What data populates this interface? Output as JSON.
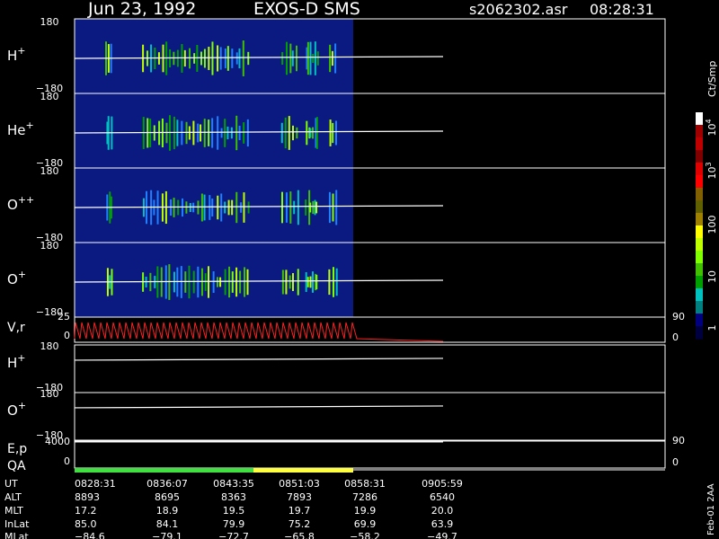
{
  "header": {
    "date": "Jun 23, 1992",
    "instrument": "EXOS-D SMS",
    "file": "s2062302.asr",
    "time": "08:28:31"
  },
  "colorbar": {
    "unit": "Ct/Smp",
    "tick_labels": [
      {
        "base": "10",
        "exp": "4"
      },
      {
        "base": "10",
        "exp": "3"
      },
      {
        "base": "100",
        "exp": ""
      },
      {
        "base": "10",
        "exp": ""
      },
      {
        "base": "1",
        "exp": ""
      }
    ],
    "colors": [
      "#ffffff",
      "#a00000",
      "#c00000",
      "#800000",
      "#e00000",
      "#ff0000",
      "#806000",
      "#606000",
      "#a08000",
      "#ffff00",
      "#c0ff00",
      "#80ff00",
      "#40c000",
      "#00a000",
      "#00c0c0",
      "#008080",
      "#000080",
      "#000040"
    ]
  },
  "footer_note": "Feb-01 2AA",
  "chart_data": {
    "type": "heatmap",
    "spectrogram_panels": [
      {
        "name": "H",
        "sup": "+",
        "ylim": [
          -180,
          180
        ],
        "yticks": [
          "180",
          "−180"
        ]
      },
      {
        "name": "He",
        "sup": "+",
        "ylim": [
          -180,
          180
        ],
        "yticks": [
          "180",
          "−180"
        ]
      },
      {
        "name": "O",
        "sup": "++",
        "ylim": [
          -180,
          180
        ],
        "yticks": [
          "180",
          "−180"
        ]
      },
      {
        "name": "O",
        "sup": "+",
        "ylim": [
          -180,
          180
        ],
        "yticks": [
          "180",
          "−180"
        ]
      }
    ],
    "vr_panel": {
      "label": "V,r",
      "left_ticks": [
        "25",
        "0"
      ],
      "right_ticks": [
        "90",
        "0"
      ],
      "trace_color": "#ff2020"
    },
    "line_panels": [
      {
        "name": "H",
        "sup": "+",
        "yticks": [
          "180",
          "−180"
        ]
      },
      {
        "name": "O",
        "sup": "+",
        "yticks": [
          "180",
          "−180"
        ]
      }
    ],
    "ep_panel": {
      "label": "E,p",
      "left_ticks": [
        "4000",
        "0"
      ],
      "right_ticks": [
        "90",
        "0"
      ]
    },
    "qa": {
      "label": "QA",
      "segments": [
        {
          "from": "0828:31",
          "to": "0843:35",
          "color": "#40e040"
        },
        {
          "from": "0843:35",
          "to": "0858:31",
          "color": "#ffff40"
        }
      ]
    },
    "ephemeris": {
      "row_labels": [
        "UT",
        "ALT",
        "MLT",
        "InLat",
        "MLat"
      ],
      "columns": [
        [
          "0828:31",
          "8893",
          "17.2",
          "85.0",
          "−84.6"
        ],
        [
          "0836:07",
          "8695",
          "18.9",
          "84.1",
          "−79.1"
        ],
        [
          "0843:35",
          "8363",
          "19.5",
          "79.9",
          "−72.7"
        ],
        [
          "0851:03",
          "7893",
          "19.7",
          "75.2",
          "−65.8"
        ],
        [
          "0858:31",
          "7286",
          "19.9",
          "69.9",
          "−58.2"
        ],
        [
          "0905:59",
          "6540",
          "20.0",
          "63.9",
          "−49.7"
        ]
      ]
    }
  }
}
